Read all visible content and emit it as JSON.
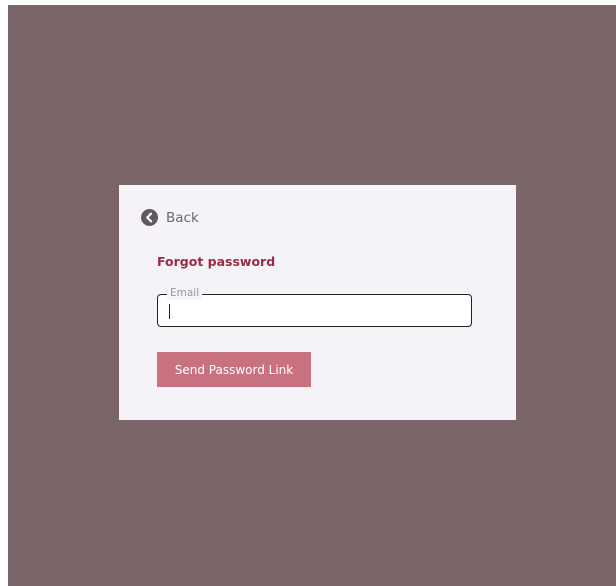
{
  "card": {
    "back_label": "Back",
    "title": "Forgot password",
    "email": {
      "label": "Email",
      "value": "",
      "placeholder": ""
    },
    "send_label": "Send Password Link"
  },
  "colors": {
    "backdrop": "#7a6668",
    "card_background": "#f5f3f8",
    "title": "#9a2a45",
    "button": "#c9727f",
    "back_icon": "#5e5a60"
  },
  "icons": {
    "back": "chevron-left-circle-icon"
  }
}
